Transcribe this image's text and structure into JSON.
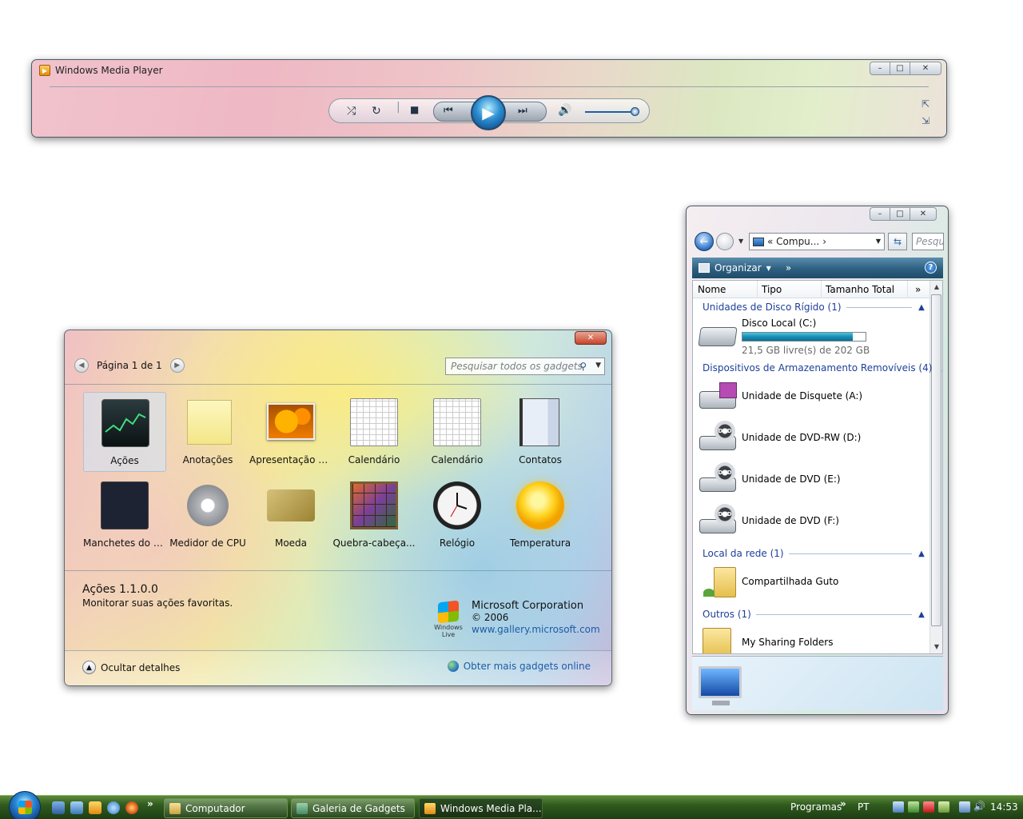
{
  "wmp": {
    "title": "Windows Media Player",
    "volume_level": 0.9
  },
  "gallery": {
    "pager": "Página 1 de 1",
    "search_placeholder": "Pesquisar todos os gadgets",
    "gadgets": [
      {
        "label": "Ações",
        "icon": "stocks-icon",
        "selected": true
      },
      {
        "label": "Anotações",
        "icon": "sticky-note-icon"
      },
      {
        "label": "Apresentação d...",
        "icon": "slideshow-icon"
      },
      {
        "label": "Calendário",
        "icon": "calendar-icon"
      },
      {
        "label": "Calendário",
        "icon": "calendar-icon"
      },
      {
        "label": "Contatos",
        "icon": "contacts-icon"
      },
      {
        "label": "Manchetes do F...",
        "icon": "feed-headlines-icon"
      },
      {
        "label": "Medidor de CPU",
        "icon": "cpu-meter-icon"
      },
      {
        "label": "Moeda",
        "icon": "currency-icon"
      },
      {
        "label": "Quebra-cabeça...",
        "icon": "puzzle-icon"
      },
      {
        "label": "Relógio",
        "icon": "clock-icon"
      },
      {
        "label": "Temperatura",
        "icon": "weather-icon"
      }
    ],
    "details": {
      "title": "Ações 1.1.0.0",
      "description": "Monitorar suas ações favoritas.",
      "publisher": "Microsoft Corporation",
      "year": "© 2006",
      "url": "www.gallery.microsoft.com",
      "logo_text": "Windows Live"
    },
    "hide_details": "Ocultar detalhes",
    "more_gadgets": "Obter mais gadgets online"
  },
  "explorer": {
    "address": "« Compu...",
    "address_arrow": "›",
    "search_placeholder": "Pesqu",
    "organize": "Organizar",
    "more": "»",
    "columns": [
      "Nome",
      "Tipo",
      "Tamanho Total"
    ],
    "columns_more": "»",
    "groups": [
      {
        "title": "Unidades de Disco Rígido (1)"
      },
      {
        "title": "Dispositivos de Armazenamento Removíveis (4)"
      },
      {
        "title": "Local da rede (1)"
      },
      {
        "title": "Outros (1)"
      }
    ],
    "items": [
      {
        "name": "Disco Local (C:)",
        "free": "21,5 GB livre(s) de 202 GB",
        "used_fraction": 0.894
      },
      {
        "name": "Unidade de Disquete (A:)"
      },
      {
        "name": "Unidade de DVD-RW (D:)"
      },
      {
        "name": "Unidade de DVD (E:)"
      },
      {
        "name": "Unidade de DVD (F:)"
      },
      {
        "name": "Compartilhada Guto"
      },
      {
        "name": "My Sharing Folders"
      }
    ]
  },
  "taskbar": {
    "buttons": [
      {
        "label": "Computador"
      },
      {
        "label": "Galeria de Gadgets"
      },
      {
        "label": "Windows Media Pla...",
        "active": true
      }
    ],
    "programs": "Programas",
    "language": "PT",
    "time": "14:53",
    "chevron": "»"
  },
  "colors": {
    "accent_blue": "#1d5ba8",
    "group_blue": "#1e3f9a",
    "taskbar_green": "#2f5a1e"
  }
}
